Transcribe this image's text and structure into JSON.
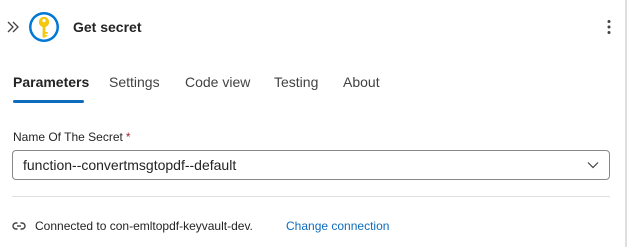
{
  "header": {
    "title": "Get secret",
    "collapse_icon": "double-chevron-right-icon",
    "action_icon": "key-vault-key-icon",
    "more_icon": "more-vertical-icon"
  },
  "tabs": [
    {
      "label": "Parameters",
      "active": true
    },
    {
      "label": "Settings",
      "active": false
    },
    {
      "label": "Code view",
      "active": false
    },
    {
      "label": "Testing",
      "active": false
    },
    {
      "label": "About",
      "active": false
    }
  ],
  "field": {
    "label": "Name Of The Secret",
    "required_marker": "*",
    "value": "function--convertmsgtopdf--default",
    "dropdown_icon": "chevron-down-icon"
  },
  "connection": {
    "icon": "connection-link-icon",
    "text": "Connected to con-emltopdf-keyvault-dev.",
    "change_label": "Change connection"
  },
  "colors": {
    "accent": "#0f6cbd",
    "key_gold": "#f2c811",
    "icon_bg": "#0078d4"
  }
}
